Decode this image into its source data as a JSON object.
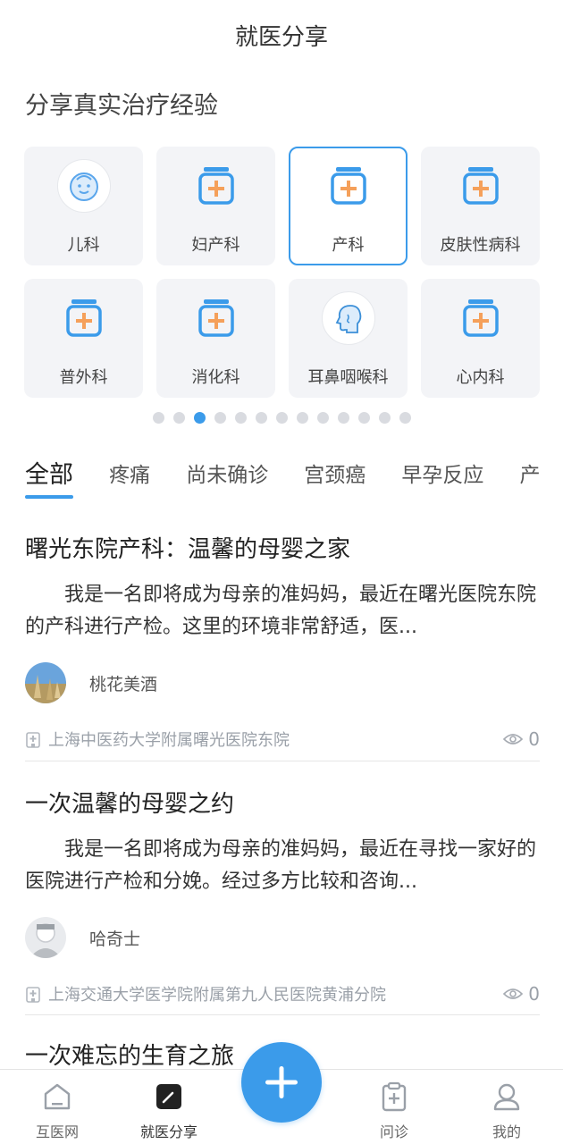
{
  "header": {
    "title": "就医分享"
  },
  "section_title": "分享真实治疗经验",
  "departments": [
    {
      "label": "儿科",
      "icon": "baby-face-icon",
      "selected": false
    },
    {
      "label": "妇产科",
      "icon": "medicine-box-icon",
      "selected": false
    },
    {
      "label": "产科",
      "icon": "medicine-box-icon",
      "selected": true
    },
    {
      "label": "皮肤性病科",
      "icon": "medicine-box-icon",
      "selected": false
    },
    {
      "label": "普外科",
      "icon": "medicine-box-icon",
      "selected": false
    },
    {
      "label": "消化科",
      "icon": "medicine-box-icon",
      "selected": false
    },
    {
      "label": "耳鼻咽喉科",
      "icon": "head-profile-icon",
      "selected": false
    },
    {
      "label": "心内科",
      "icon": "medicine-box-icon",
      "selected": false
    }
  ],
  "pager": {
    "total": 13,
    "active_index": 2
  },
  "tabs": [
    "全部",
    "疼痛",
    "尚未确诊",
    "宫颈癌",
    "早孕反应",
    "产"
  ],
  "active_tab": 0,
  "posts": [
    {
      "title": "曙光东院产科：温馨的母婴之家",
      "excerpt": "我是一名即将成为母亲的准妈妈，最近在曙光医院东院的产科进行产检。这里的环境非常舒适，医...",
      "author": "桃花美酒",
      "hospital": "上海中医药大学附属曙光医院东院",
      "views": "0"
    },
    {
      "title": "一次温馨的母婴之约",
      "excerpt": "我是一名即将成为母亲的准妈妈，最近在寻找一家好的医院进行产检和分娩。经过多方比较和咨询...",
      "author": "哈奇士",
      "hospital": "上海交通大学医学院附属第九人民医院黄浦分院",
      "views": "0"
    },
    {
      "title": "一次难忘的生育之旅"
    }
  ],
  "tabbar": {
    "items": [
      {
        "label": "互医网",
        "icon": "home-icon"
      },
      {
        "label": "就医分享",
        "icon": "edit-note-icon"
      },
      {
        "label": "问诊",
        "icon": "clipboard-plus-icon"
      },
      {
        "label": "我的",
        "icon": "user-icon"
      }
    ],
    "fab_icon": "plus-icon"
  },
  "colors": {
    "accent": "#3b9bea",
    "orange": "#f5a05a",
    "card_bg": "#f3f4f7"
  }
}
